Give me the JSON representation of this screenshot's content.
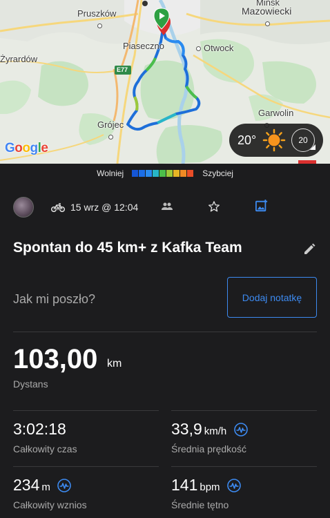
{
  "map": {
    "places": {
      "pruszkow": "Pruszków",
      "mazowiecki": "Mazowiecki",
      "minsk": "Mińsk",
      "piaseczno": "Piaseczno",
      "otwock": "Otwock",
      "zyrardow": "Żyrardów",
      "road": "E77",
      "garwolin": "Garwolin",
      "grojec": "Grójec"
    },
    "google_logo": [
      "G",
      "o",
      "o",
      "g",
      "l",
      "e"
    ],
    "weather": {
      "temperature": "20°",
      "wind": "20",
      "icon": "sun-icon"
    },
    "route_color": "#1e6fd9"
  },
  "speed_legend": {
    "slow_label": "Wolniej",
    "fast_label": "Szybciej",
    "colors": [
      "#1556d6",
      "#1b6ee8",
      "#2a8bf0",
      "#27b6c8",
      "#4cbf4a",
      "#9cc93a",
      "#e7b525",
      "#f08a24",
      "#ea4e28"
    ]
  },
  "activity": {
    "type_icon": "bike-icon",
    "date": "15 wrz @ 12:04",
    "title": "Spontan do 45 km+ z Kafka Team",
    "note_prompt": "Jak mi poszło?",
    "add_note_label": "Dodaj notatkę"
  },
  "stats": {
    "distance": {
      "value": "103,00",
      "unit": "km",
      "label": "Dystans"
    },
    "total_time": {
      "value": "3:02:18",
      "label": "Całkowity czas"
    },
    "avg_speed": {
      "value": "33,9",
      "unit": "km/h",
      "label": "Średnia prędkość"
    },
    "elevation": {
      "value": "234",
      "unit": "m",
      "label": "Całkowity wznios"
    },
    "avg_hr": {
      "value": "141",
      "unit": "bpm",
      "label": "Średnie tętno"
    }
  }
}
